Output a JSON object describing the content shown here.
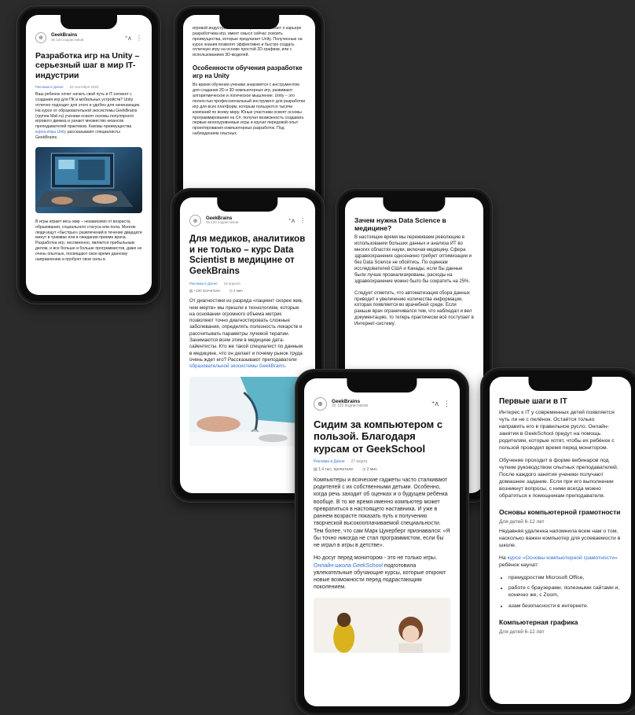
{
  "phone1": {
    "channel": "GeekBrains",
    "subscribers": "35 120 подписчиков",
    "title": "Разработка игр на Unity – серьезный шаг в мир IT-индустрии",
    "category": "Реклама в Дзене",
    "date": "23 сентября 2020",
    "body1": "Ваш ребенок хочет начать свой путь в IT-сегмент с создания игр для ПК и мобильных устройств? Unity отлично подходит для этого и удобен для начинающих. На курсе от образовательной экосистемы GeekBrains (группа Mail.ru) ученики освоят основы популярного игрового движка и узнают множество нюансов преподавателей практиков. Каковы преимущества",
    "body1_link": "курса игры Unity",
    "body1_end": "рассказывают специалисты GeekBrains.",
    "body2": "В игры играет весь мир – независимо от возраста, образования, социального статуса или пола. Многие люди ищут «быстрых» развлечений в течение двадцати минут в трамвае или в ожидании приема врача. Разработка игр, несомненно, является прибыльным делом, и все больше и больше программистов, даже не очень опытных, посвящают свое время данному направлению и пробуют свои силы в"
  },
  "phone2": {
    "top_text": "игровой индустрии. Если ваш ребенок мечтает о карьере разработчика игр, имеет смысл сейчас освоить преимущества, которые предлагает Unity. Полученные на курсе знания позволят эффективно и быстро создать отличную игру на основе простой 2D-графики, или с использованием 3D-моделей.",
    "heading": "Особенности обучения разработке игр на Unity",
    "body": "Во время обучения ученики знакомятся с инструментом для создания 2D и 3D компьютерных игр, развивают алгоритмическое и логическое мышление. Unity – это полностью профессиональный инструмент для разработки игр для всех платформ, которым пользуются тысячи компаний по всему миру. Юные участники освоят основы программирования на C#, получат возможность создавать первые многоуровневые игры и изучат передовой опыт проектирования компьютерных разработок. Под наблюдением опытных"
  },
  "phone3": {
    "channel": "GeekBrains",
    "subscribers": "35 120 подписчиков",
    "title": "Для медиков, аналитиков и не только – курс Data Scientist в медицине от GeekBrains",
    "category": "Реклама в Дзене",
    "date": "18 апреля",
    "views": "+100 прочитали",
    "read_time": "2 мин",
    "body": "От диагностики из разряда «пациент скорее жив, чем мертв» мы пришли к технологиям, которые на основании огромного объема метрик позволяют точно диагностировать сложные заболевания, определять полезность лекарств и рассчитывать параметры лучевой терапии. Занимаются всем этим в медицине дата-сайентисты. Кто же такой специалист по данным в медицине, что он делает и почему рынок труда очень ждет его? Рассказывают преподаватели",
    "body_link": "образовательной экосистемы GeekBrains",
    "body_end": "."
  },
  "phone4": {
    "heading": "Зачем нужна Data Science в медицине?",
    "p1": "В настоящее время мы переживаем революцию в использовании больших данных и анализа ИТ во многих областях науки, включая медицину. Сфера здравоохранения однозначно требует оптимизации и без Data Science не обойтись. По оценкам исследователей США и Канады, если бы данные были лучше проанализированы, расходы на здравоохранение можно было бы сократить на 25%.",
    "p2": "Следует отметить, что автоматизация сбора данных приводит к увеличению количества информации, которая появляется во врачебной среде. Если раньше врач ограничивался тем, что наблюдал и вел документацию, то теперь практически всё поступает в Интернет-систему:"
  },
  "phone5": {
    "channel": "GeekBrains",
    "subscribers": "35 120 подписчиков",
    "title": "Сидим за компьютером с пользой. Благодаря курсам от GeekSchool",
    "category": "Реклама в Дзене",
    "date": "27 марта",
    "views": "1,4 тыс. прочитали",
    "read_time": "2 мин",
    "p1": "Компьютеры и всяческие гаджеты часто сталкивают родителей с их собственными детьми. Особенно, когда речь заходит об оценках и о будущем ребёнка вообще. В то же время именно компьютер может превратиться в настоящего наставника. И уже в раннем возрасте показать путь к получению творческой высокооплачиваемой специальности. Тем более, что сам Марк Цукерберг признавался: «Я бы точно никогда не стал программистом, если бы не играл в игры в детстве».",
    "p2_start": "Но досуг перед монитором - это не только игры.",
    "p2_link": "Онлайн-школа GeekSchool",
    "p2_end": "подготовила увлекательные обучающие курсы, которые откроют новые возможности перед подрастающим поколением."
  },
  "phone6": {
    "heading": "Первые шаги в IT",
    "p1": "Интерес к IT у современных детей появляется чуть ли не с пелёнок. Остаётся только направить его в правильное русло. Онлайн-занятия в GeekSchool придут на помощь родителям, которые хотят, чтобы их ребёнок с пользой проводил время перед монитором.",
    "p2": "Обучение проходит в форме вебинаров под чутким руководством опытных преподавателей. После каждого занятия ученики получают домашнее задание. Если при его выполнении возникнут вопросы, с ними всегда можно обратиться к помощникам преподавателя.",
    "sub1": "Основы компьютерной грамотности",
    "age1": "Для детей 6-12 лет",
    "p3": "Недавняя удаленка напомнила всем нам о том, насколько важен компьютер для успеваемости в школе.",
    "p4_start": "На",
    "p4_link": "курсе «Основы компьютерной грамотности»",
    "p4_end": "ребёнок научат:",
    "bullets": [
      "премудростям Microsoft Office,",
      "работе с браузерами, полезными сайтами и, конечно же, с Zoom,",
      "азам безопасности в интернете."
    ],
    "sub2": "Компьютерная графика",
    "age2": "Для детей 6-12 лет"
  }
}
